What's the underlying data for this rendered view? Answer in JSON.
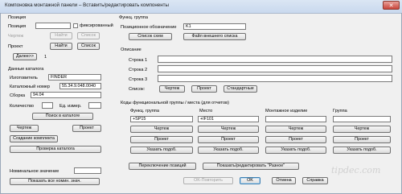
{
  "window": {
    "title": "Компоновка монтажной панели – Вставить/редактировать компоненты",
    "close_glyph": "✕"
  },
  "position": {
    "heading": "Позиция",
    "label": "Позиция",
    "value": "",
    "fixed_label": "фиксированный",
    "fixed_checked": false,
    "drawing_label": "Чертеж",
    "find_label": "Найти",
    "list_label": "Список"
  },
  "project": {
    "label": "Проект",
    "find_label": "Найти",
    "list_label": "Список",
    "next_label": "Далее>>",
    "next_value": "1"
  },
  "catalog": {
    "heading": "Данные каталога",
    "manufacturer_label": "Изготовитель",
    "manufacturer_value": "FINDER",
    "catalog_number_label": "Каталожный номер",
    "catalog_number_value": "55.34.9.048.0040",
    "assembly_label": "Сборка",
    "assembly_value": "94.04",
    "quantity_label": "Количество",
    "quantity_value": "",
    "unit_label": "Ед. измер.",
    "unit_value": "",
    "search_label": "Поиск в каталоге",
    "drawing_label": "Чертеж",
    "project_label": "Проект",
    "create_kit_label": "Создание комплекта",
    "check_catalog_label": "Проверка каталога"
  },
  "nominal": {
    "label": "Номинальное значение",
    "value": "",
    "show_all_label": "Показать все номин. знач."
  },
  "func_group": {
    "heading": "Функц. группа",
    "positional_label": "Позиционное обозначение",
    "positional_value": "K1",
    "schemes_list_label": "Список схем",
    "external_file_list_label": "Файл внешнего списка"
  },
  "description": {
    "heading": "Описание",
    "line1_label": "Строка 1",
    "line1_value": "",
    "line2_label": "Строка 2",
    "line2_value": "",
    "line3_label": "Строка 3",
    "line3_value": "",
    "list_label": "Список:",
    "drawing_label": "Чертеж",
    "project_label": "Проект",
    "standard_label": "Стандартные"
  },
  "codes": {
    "heading": "Коды функциональной группы / места (для отчетов)",
    "col_func_group": "Функц. группа",
    "col_place": "Место",
    "col_mount": "Монтажное изделие",
    "col_group": "Группа",
    "func_group_value": "+SP15",
    "place_value": "+IF101",
    "drawing_label": "Чертеж",
    "project_label": "Проект",
    "specify_label": "Указать подоб."
  },
  "bottom": {
    "switch_positions_label": "Переключение позиций",
    "show_edit_various_label": "Показать/редактировать \"Разное\"",
    "ok_repeat_label": "OK-Повторить",
    "ok_label": "OK",
    "cancel_label": "Отмена",
    "help_label": "Справка"
  },
  "watermark": "tipdec.com"
}
